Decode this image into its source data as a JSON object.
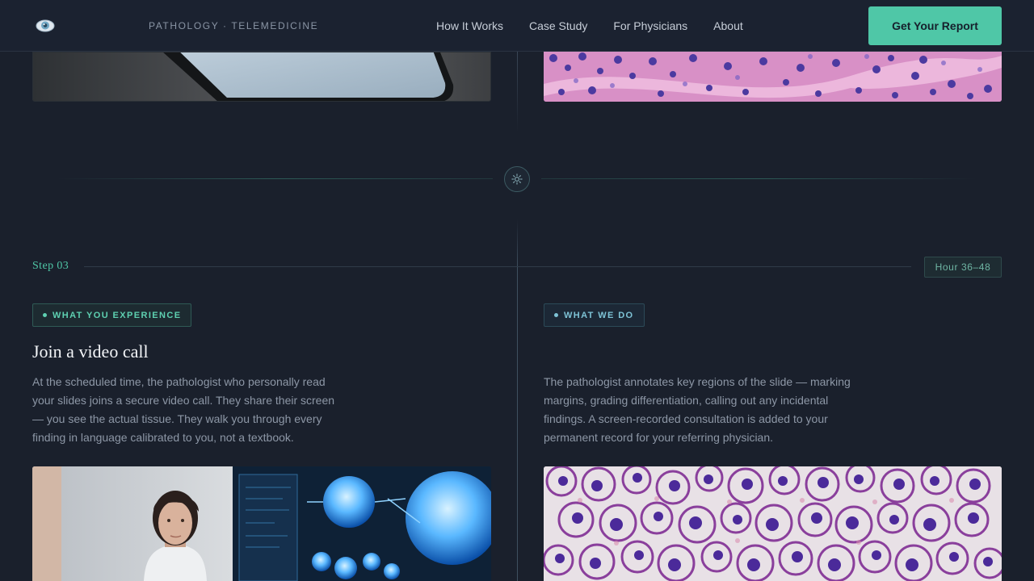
{
  "header": {
    "brand_tag": "PATHOLOGY · TELEMEDICINE",
    "nav": [
      "How It Works",
      "Case Study",
      "For Physicians",
      "About"
    ],
    "cta_label": "Get Your Report"
  },
  "step": {
    "label": "Step 03",
    "hour_badge": "Hour 36–48",
    "left": {
      "tag": "WHAT YOU EXPERIENCE",
      "heading": "Join a video call",
      "body": "At the scheduled time, the pathologist who personally read your slides joins a secure video call. They share their screen — you see the actual tissue. They walk you through every finding in language calibrated to you, not a textbook."
    },
    "right": {
      "tag": "WHAT WE DO",
      "body": "The pathologist annotates key regions of the slide — marking margins, grading differentiation, calling out any incidental findings. A screen-recorded consultation is added to your permanent record for your referring physician."
    }
  },
  "colors": {
    "background": "#1a202c",
    "accent": "#4fc7a7",
    "secondary_accent": "#7ec3d6"
  },
  "icons": {
    "logo": "eye-logo-icon",
    "divider": "sun-icon"
  }
}
